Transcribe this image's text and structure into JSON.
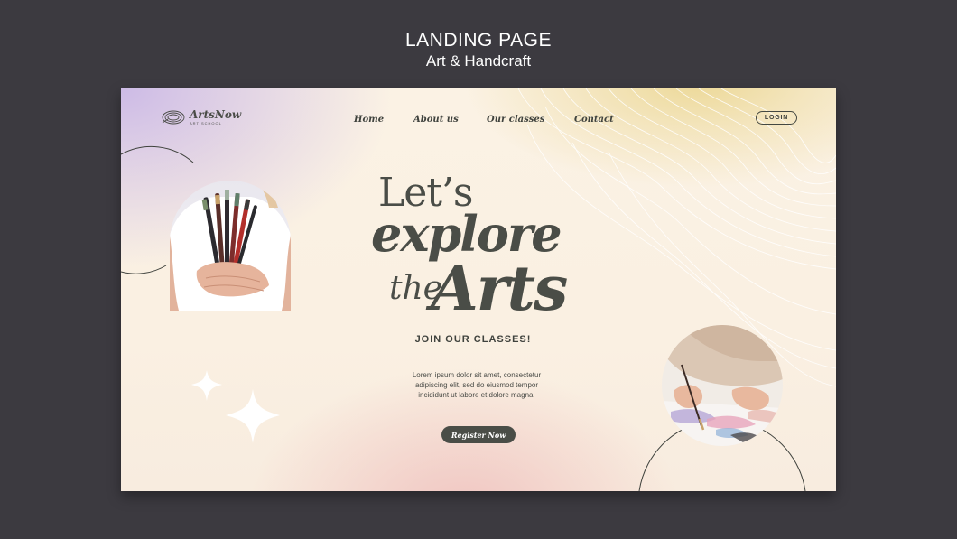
{
  "showcase": {
    "title": "LANDING PAGE",
    "subtitle": "Art & Handcraft"
  },
  "brand": {
    "name": "ArtsNow",
    "tagline": "ART SCHOOL",
    "icon": "palette-swirl-icon"
  },
  "nav": {
    "items": [
      {
        "label": "Home"
      },
      {
        "label": "About us"
      },
      {
        "label": "Our classes"
      },
      {
        "label": "Contact"
      }
    ],
    "login_label": "LOGIN"
  },
  "hero": {
    "line1": "Let’s",
    "line2": "explore",
    "line3_small": "the",
    "line3_large": "Arts"
  },
  "cta": {
    "join": "JOIN OUR CLASSES!",
    "description": "Lorem ipsum dolor sit amet, consectetur adipiscing elit, sed do eiusmod tempor incididunt ut labore et dolore magna.",
    "register_label": "Register Now"
  },
  "colors": {
    "background": "#3c3a40",
    "text_dark": "#4a4d47",
    "accent_lavender": "#cdbbe6",
    "accent_gold": "#ecd896",
    "accent_pink": "#f0c5c1"
  }
}
